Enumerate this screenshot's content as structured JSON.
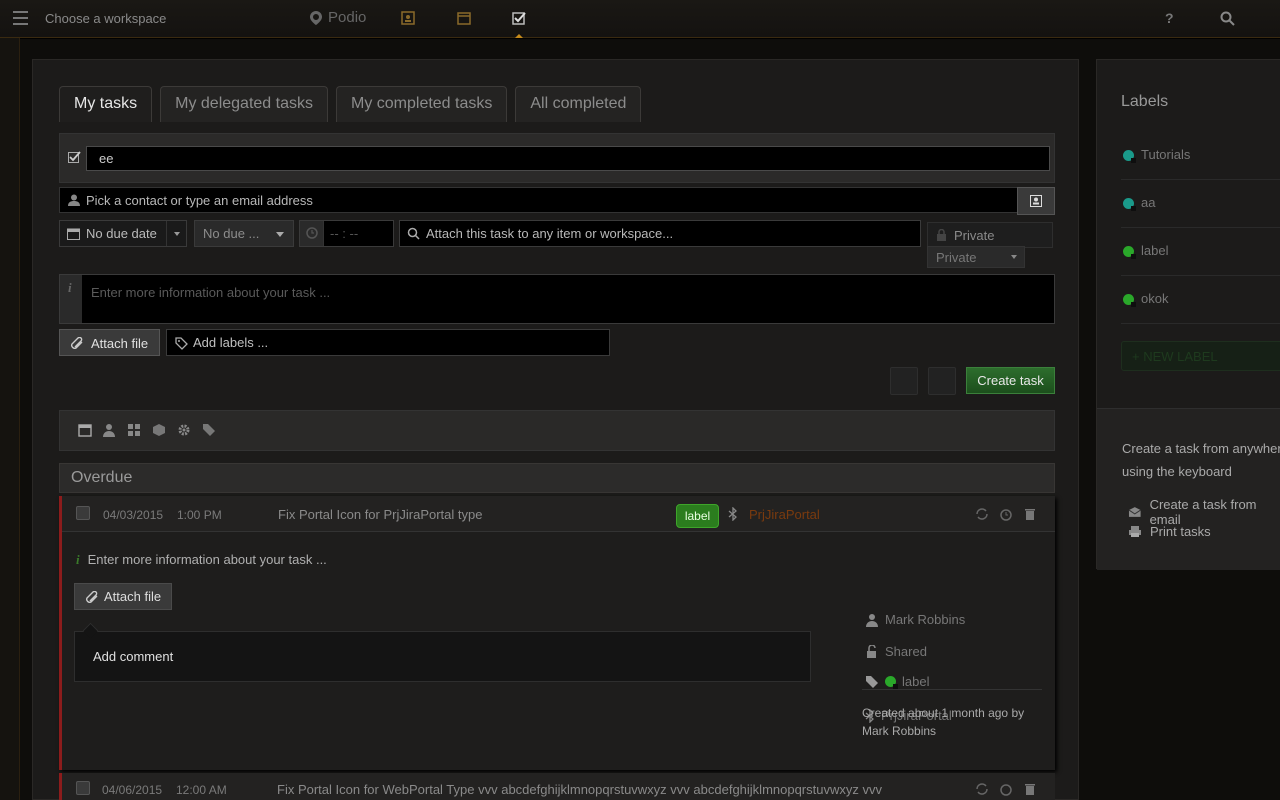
{
  "topbar": {
    "workspace": "Choose a workspace",
    "logo": "Podio",
    "help": "?"
  },
  "tabs": [
    {
      "label": "My tasks"
    },
    {
      "label": "My delegated tasks"
    },
    {
      "label": "My completed tasks"
    },
    {
      "label": "All completed"
    }
  ],
  "form": {
    "task_value": "ee",
    "contact_placeholder": "Pick a contact or type an email address",
    "due_date": "No due date",
    "due_select": "No due ...",
    "time_placeholder": "-- : --",
    "attach_to_placeholder": "Attach this task to any item or workspace...",
    "privacy": "Private",
    "privacy_select": "Private",
    "description_placeholder": "Enter more information about your task ...",
    "attach_file": "Attach file",
    "labels_placeholder": "Add labels ...",
    "create": "Create task"
  },
  "section": "Overdue",
  "tasks": [
    {
      "date": "04/03/2015",
      "time": "1:00 PM",
      "title": "Fix Portal Icon for PrjJiraPortal type",
      "label": "label",
      "link": "PrjJiraPortal",
      "details": {
        "description_placeholder": "Enter more information about your task ...",
        "attach_file": "Attach file",
        "comment": "Add comment",
        "assignee": "Mark Robbins",
        "visibility": "Shared",
        "label": "label",
        "reference": "PrjJiraPortal",
        "created": "Created about 1 month ago by Mark Robbins"
      }
    },
    {
      "date": "04/06/2015",
      "time": "12:00 AM",
      "title": "Fix Portal Icon for WebPortal Type vvv abcdefghijklmnopqrstuvwxyz vvv abcdefghijklmnopqrstuvwxyz vvv"
    }
  ],
  "sidebar": {
    "title": "Labels",
    "labels": [
      {
        "name": "Tutorials",
        "color": "#1a9a8a"
      },
      {
        "name": "aa",
        "color": "#1a9a8a"
      },
      {
        "name": "label",
        "color": "#2aa82a"
      },
      {
        "name": "okok",
        "color": "#2aa82a"
      }
    ],
    "new_label": "+ NEW LABEL",
    "tip": "Create a task from anywhere using the keyboard",
    "email_link": "Create a task from email",
    "print_link": "Print tasks"
  },
  "colors": {
    "accent": "#c58a1a",
    "create": "#2d6d2d",
    "overdue": "#8c1c1c"
  }
}
